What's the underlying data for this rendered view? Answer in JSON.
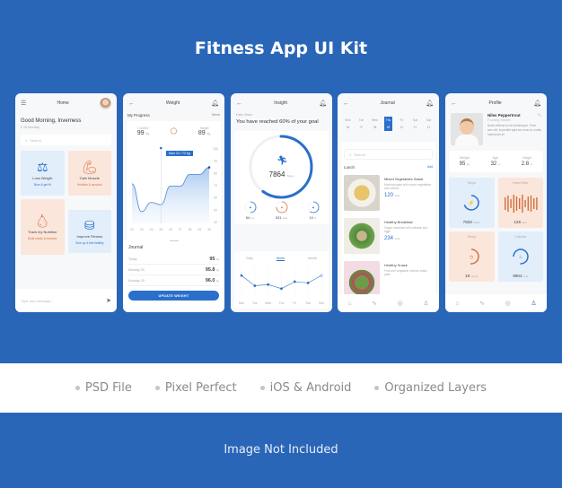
{
  "title": "Fitness App UI Kit",
  "features": [
    "PSD File",
    "Pixel Perfect",
    "iOS & Android",
    "Organized Layers"
  ],
  "footer": "Image Not Included",
  "colors": {
    "background": "#2a66b8",
    "accent": "#2a6fca",
    "orange": "#d2703e",
    "tile_blue": "#e3eefb",
    "tile_orange": "#fbe6dc"
  },
  "home": {
    "title": "Home",
    "greeting": "Good Morning, Inverness",
    "date": "9 15 Monday",
    "search_placeholder": "Search",
    "tiles": [
      {
        "name": "Loss Weight",
        "sub": "Burn & get fit",
        "icon": "scale-icon"
      },
      {
        "name": "Gain Muscle",
        "sub": "Nutrition & muscles",
        "icon": "muscle-icon"
      },
      {
        "name": "Track my Nutrition",
        "sub": "Build meals & muscles",
        "icon": "pear-icon"
      },
      {
        "name": "Improve Fitness",
        "sub": "Tone up & feel healthy",
        "icon": "dumbbell-icon"
      }
    ],
    "message_placeholder": "Type any message..."
  },
  "weight": {
    "title": "Weight",
    "progress_label": "My Progress",
    "period": "Week",
    "current_label": "Current",
    "current_value": "99",
    "target_label": "Target",
    "target_value": "89",
    "unit": "kg",
    "tooltip": "Mon 31 / 72 kg",
    "chart_data": {
      "type": "area",
      "x": [
        "22",
        "23",
        "24",
        "25",
        "26",
        "27",
        "28",
        "29",
        "30"
      ],
      "values": [
        74,
        50,
        58,
        56,
        72,
        72,
        82,
        82,
        88
      ],
      "y_ticks": [
        "100",
        "90",
        "80",
        "70",
        "60",
        "50",
        "40"
      ],
      "ylim": [
        40,
        100
      ],
      "highlight_x": "25"
    },
    "journal_title": "Journal",
    "journal": [
      {
        "label": "Today",
        "value": "95"
      },
      {
        "label": "Monday 30",
        "value": "95.8"
      },
      {
        "label": "Monday 29",
        "value": "96.0"
      }
    ],
    "update_button": "UPDATE WEIGHT"
  },
  "insight": {
    "title": "Insight",
    "kicker": "Daily Steps",
    "headline": "You have reached 60% of your goal",
    "goal_progress": 0.6,
    "steps_value": "7864",
    "steps_unit": "Steps",
    "minis": [
      {
        "value": "54",
        "unit": "km",
        "progress": 0.5,
        "color": "#2a6fca",
        "icon": "location-icon"
      },
      {
        "value": "531",
        "unit": "kcal",
        "progress": 0.75,
        "color": "#d2703e",
        "icon": "flame-icon"
      },
      {
        "value": "10",
        "unit": "hr",
        "progress": 0.6,
        "color": "#2a6fca",
        "icon": "clock-icon"
      }
    ],
    "tabs": [
      "Daily",
      "Week",
      "Month"
    ],
    "active_tab": 1,
    "chart_data": {
      "type": "line",
      "x": [
        "Mon",
        "Tue",
        "Wed",
        "Thu",
        "Fri",
        "Sat",
        "Sun"
      ],
      "values": [
        80,
        55,
        58,
        48,
        65,
        62,
        80
      ],
      "ylim": [
        30,
        100
      ]
    }
  },
  "journal": {
    "title": "Journal",
    "days": [
      {
        "d": "Mon",
        "n": "06"
      },
      {
        "d": "Tue",
        "n": "07"
      },
      {
        "d": "Wed",
        "n": "08"
      },
      {
        "d": "Thu",
        "n": "09"
      },
      {
        "d": "Fri",
        "n": "10"
      },
      {
        "d": "Sat",
        "n": "11"
      },
      {
        "d": "Sun",
        "n": "12"
      }
    ],
    "active_day": 3,
    "search_placeholder": "Search",
    "section": "Lunch",
    "add_label": "Add",
    "foods": [
      {
        "name": "Mixed Vegetables Salad",
        "desc": "Morning salad with mixed vegetables and cheese",
        "kcal": "120",
        "unit": "kcal"
      },
      {
        "name": "Healthy Breakfast",
        "desc": "Vegan breakfast with oatmeal and eggs",
        "kcal": "234",
        "unit": "kcal"
      },
      {
        "name": "Healthy Snack",
        "desc": "Fruit and vegetable cheese snack plate",
        "kcal": "",
        "unit": ""
      }
    ]
  },
  "profile": {
    "title": "Profile",
    "name": "Niles Peppertrout",
    "role": "Founding member",
    "bio": "Nulla eleifend et est scelerisque. Proin sem elit, imperdiet eget ere risus et, mattis maecenas ex",
    "stats": [
      {
        "label": "Weight",
        "value": "95",
        "unit": "kg"
      },
      {
        "label": "Age",
        "value": "32",
        "unit": "yr"
      },
      {
        "label": "Height",
        "value": "2.8",
        "unit": "m"
      }
    ],
    "tiles": [
      {
        "label": "Steps",
        "value": "7832",
        "unit": "Steps"
      },
      {
        "label": "Heart Rate",
        "value": "125",
        "unit": "bpm"
      },
      {
        "label": "Sleep",
        "value": "19",
        "unit": "Hours"
      },
      {
        "label": "Calories",
        "value": "8902",
        "unit": "kcal"
      }
    ]
  }
}
